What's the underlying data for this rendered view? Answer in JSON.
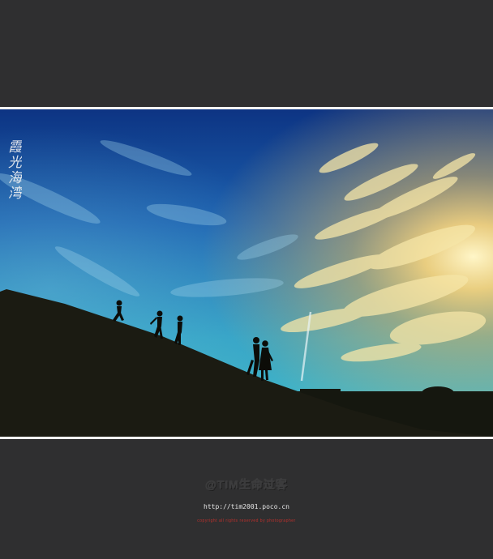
{
  "photo": {
    "calligraphy_mark": "霞光海湾"
  },
  "footer": {
    "signature": "@TIM生命过客",
    "url": "http://tim2001.poco.cn",
    "small_red_text": "copyright all rights reserved by photographer"
  },
  "colors": {
    "background": "#2f2f30",
    "border": "#f2f2f2",
    "sky_top": "#0f3f8e",
    "sky_horizon": "#39b3c9",
    "glow": "#ffd77a",
    "hill": "#1a1a12"
  }
}
